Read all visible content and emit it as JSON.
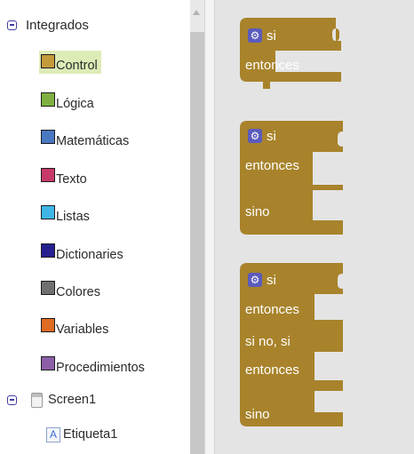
{
  "tree": {
    "root_label": "Integrados",
    "categories": [
      {
        "label": "Control",
        "color": "#c49b3b",
        "selected": true
      },
      {
        "label": "Lógica",
        "color": "#7fb041"
      },
      {
        "label": "Matemáticas",
        "color": "#4a78c2"
      },
      {
        "label": "Texto",
        "color": "#c73a68"
      },
      {
        "label": "Listas",
        "color": "#3fb6e6"
      },
      {
        "label": "Dictionaries",
        "color": "#26208f"
      },
      {
        "label": "Colores",
        "color": "#707070"
      },
      {
        "label": "Variables",
        "color": "#dd6b24"
      },
      {
        "label": "Procedimientos",
        "color": "#8c5fa8"
      }
    ],
    "screen_label": "Screen1",
    "component_label": "Etiqueta1",
    "component_icon_letter": "A"
  },
  "workspace": {
    "block_color": "#a8832b",
    "gear_glyph": "⚙",
    "blocks": [
      {
        "lines": [
          "si",
          "entonces"
        ]
      },
      {
        "lines": [
          "si",
          "entonces",
          "sino"
        ]
      },
      {
        "lines": [
          "si",
          "entonces",
          "si no, si",
          "entonces",
          "sino"
        ]
      }
    ]
  }
}
